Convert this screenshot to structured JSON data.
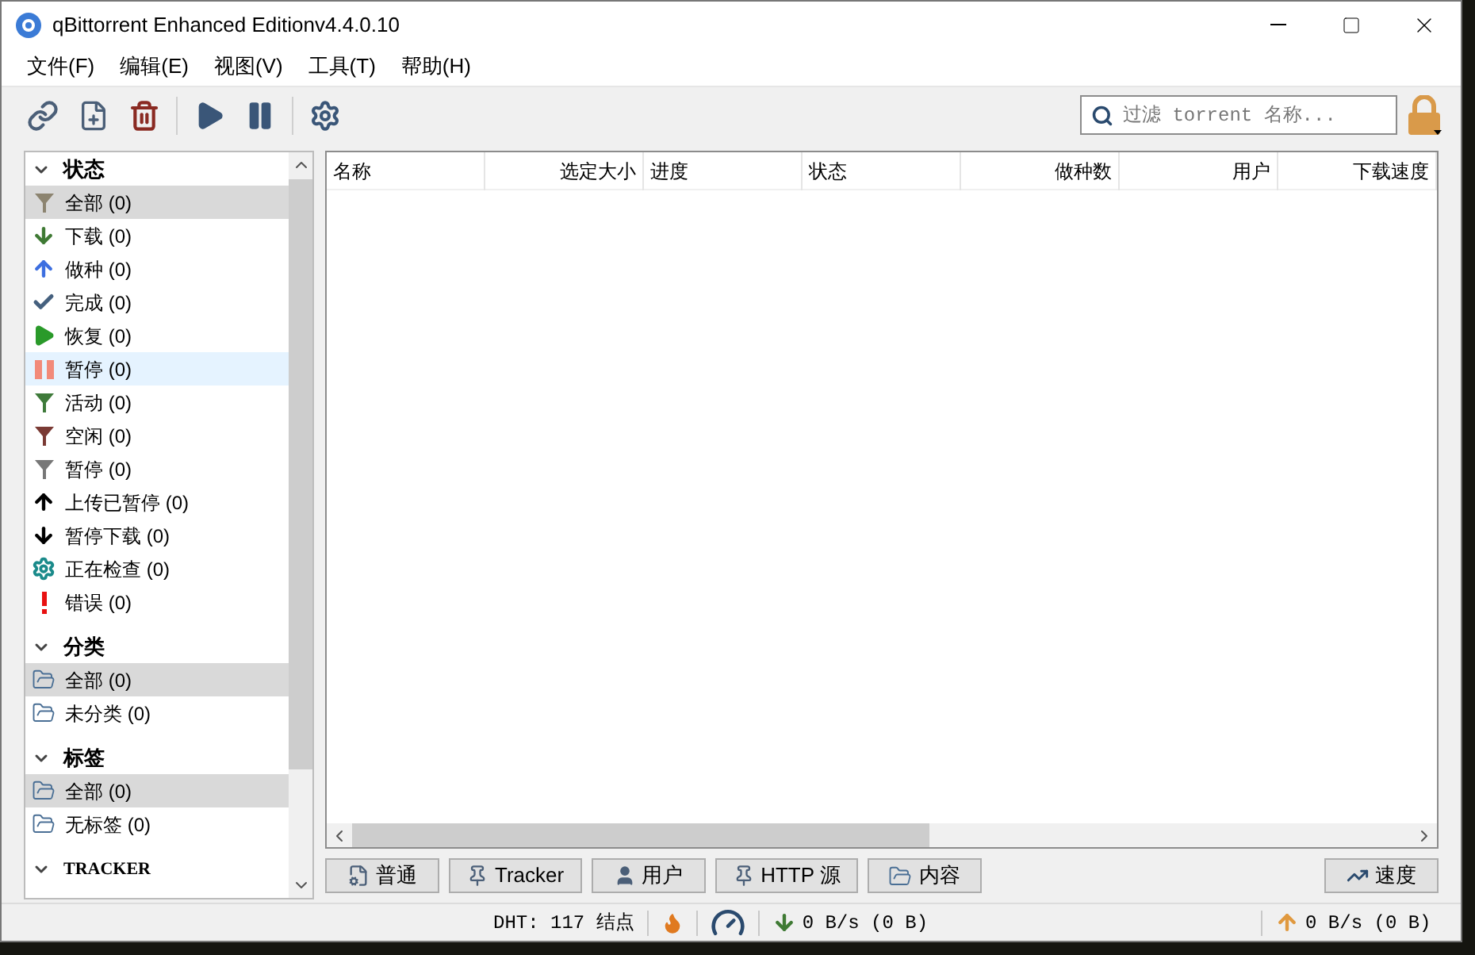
{
  "window": {
    "title": "qBittorrent Enhanced Editionv4.4.0.10"
  },
  "menu": [
    "文件(F)",
    "编辑(E)",
    "视图(V)",
    "工具(T)",
    "帮助(H)"
  ],
  "search": {
    "placeholder": "过滤 torrent 名称..."
  },
  "sidebar": {
    "sections": [
      {
        "title": "状态",
        "kind": "cjk",
        "expanded": true,
        "items": [
          {
            "label": "全部 (0)",
            "kind": "filter-all",
            "selected": true,
            "hovered": false
          },
          {
            "label": "下载 (0)",
            "kind": "down",
            "selected": false,
            "hovered": false
          },
          {
            "label": "做种 (0)",
            "kind": "up",
            "selected": false,
            "hovered": false
          },
          {
            "label": "完成 (0)",
            "kind": "check",
            "selected": false,
            "hovered": false
          },
          {
            "label": "恢复 (0)",
            "kind": "play",
            "selected": false,
            "hovered": false
          },
          {
            "label": "暂停 (0)",
            "kind": "pause",
            "selected": false,
            "hovered": true
          },
          {
            "label": "活动 (0)",
            "kind": "filter-active",
            "selected": false,
            "hovered": false
          },
          {
            "label": "空闲 (0)",
            "kind": "filter-idle",
            "selected": false,
            "hovered": false
          },
          {
            "label": "暂停 (0)",
            "kind": "filter-paused",
            "selected": false,
            "hovered": false
          },
          {
            "label": "上传已暂停 (0)",
            "kind": "up-black",
            "selected": false,
            "hovered": false
          },
          {
            "label": "暂停下载 (0)",
            "kind": "down-black",
            "selected": false,
            "hovered": false
          },
          {
            "label": "正在检查 (0)",
            "kind": "gear",
            "selected": false,
            "hovered": false
          },
          {
            "label": "错误 (0)",
            "kind": "error",
            "selected": false,
            "hovered": false
          }
        ]
      },
      {
        "title": "分类",
        "kind": "cjk",
        "expanded": true,
        "items": [
          {
            "label": "全部 (0)",
            "kind": "folder",
            "selected": true,
            "hovered": false
          },
          {
            "label": "未分类 (0)",
            "kind": "folder",
            "selected": false,
            "hovered": false
          }
        ]
      },
      {
        "title": "标签",
        "kind": "cjk",
        "expanded": true,
        "items": [
          {
            "label": "全部 (0)",
            "kind": "folder",
            "selected": true,
            "hovered": false
          },
          {
            "label": "无标签 (0)",
            "kind": "folder",
            "selected": false,
            "hovered": false
          }
        ]
      },
      {
        "title": "TRACKER",
        "kind": "latin",
        "expanded": true
      }
    ]
  },
  "table": {
    "columns": [
      "名称",
      "选定大小",
      "进度",
      "状态",
      "做种数",
      "用户",
      "下载速度"
    ]
  },
  "detail_tabs": [
    {
      "label": "普通",
      "kind": "file-gear"
    },
    {
      "label": "Tracker",
      "kind": "pin"
    },
    {
      "label": "用户",
      "kind": "user-search"
    },
    {
      "label": "HTTP 源",
      "kind": "pin"
    },
    {
      "label": "内容",
      "kind": "folder"
    }
  ],
  "speed_button": "速度",
  "status_bar": {
    "dht": "DHT: 117 结点",
    "download": "0 B/s (0 B)",
    "upload": "0 B/s (0 B)"
  }
}
